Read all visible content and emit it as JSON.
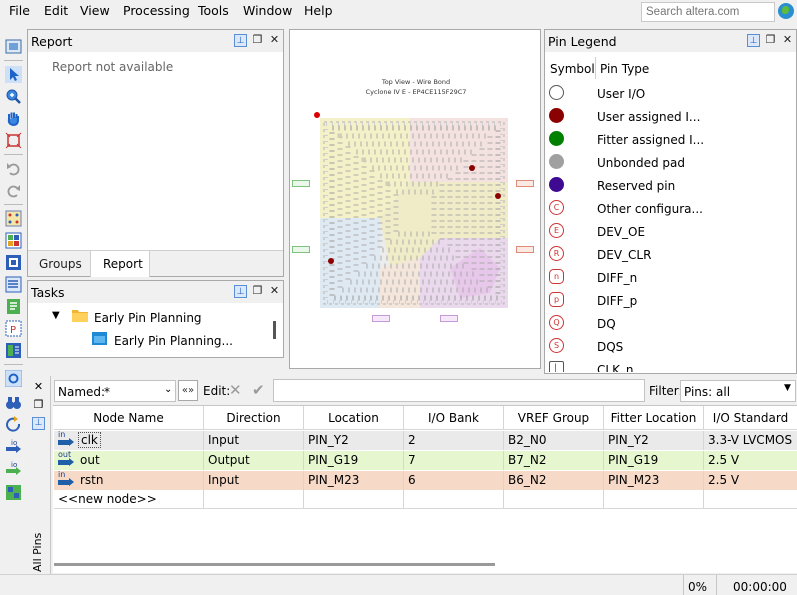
{
  "menu": [
    "File",
    "Edit",
    "View",
    "Processing",
    "Tools",
    "Window",
    "Help"
  ],
  "search": {
    "placeholder": "Search altera.com"
  },
  "report_panel": {
    "title": "Report",
    "empty_message": "Report not available",
    "tabs": [
      "Groups",
      "Report"
    ]
  },
  "tasks_panel": {
    "title": "Tasks",
    "items": [
      "Early Pin Planning",
      "Early Pin Planning..."
    ]
  },
  "chip_view": {
    "title": "Top View - Wire Bond",
    "subtitle": "Cyclone IV E - EP4CE115F29C7"
  },
  "pin_legend": {
    "title": "Pin Legend",
    "headers": [
      "Symbol",
      "Pin Type"
    ],
    "items": [
      {
        "label": "User I/O",
        "color": "#ffffff",
        "letter": ""
      },
      {
        "label": "User assigned I...",
        "color": "#8b0000",
        "letter": ""
      },
      {
        "label": "Fitter assigned I...",
        "color": "#008000",
        "letter": ""
      },
      {
        "label": "Unbonded pad",
        "color": "#a0a0a0",
        "letter": ""
      },
      {
        "label": "Reserved pin",
        "color": "#3d0a91",
        "letter": ""
      },
      {
        "label": "Other configura...",
        "color": "#ffffff",
        "letter": "C"
      },
      {
        "label": "DEV_OE",
        "color": "#ffffff",
        "letter": "E"
      },
      {
        "label": "DEV_CLR",
        "color": "#ffffff",
        "letter": "R"
      },
      {
        "label": "DIFF_n",
        "color": "#ffffff",
        "letter": "n"
      },
      {
        "label": "DIFF_p",
        "color": "#ffffff",
        "letter": "p"
      },
      {
        "label": "DQ",
        "color": "#ffffff",
        "letter": "Q"
      },
      {
        "label": "DQS",
        "color": "#ffffff",
        "letter": "S"
      },
      {
        "label": "CLK_n",
        "color": "#ffffff",
        "letter": "⎣"
      }
    ]
  },
  "filter_bar": {
    "named_label": "Named:",
    "named_value": "*",
    "edit_label": "Edit:",
    "filter_label": "Filter:",
    "filter_value": "Pins: all"
  },
  "pin_table": {
    "side_tab": "All Pins",
    "headers": [
      "Node Name",
      "Direction",
      "Location",
      "I/O Bank",
      "VREF Group",
      "Fitter Location",
      "I/O Standard"
    ],
    "rows": [
      {
        "dir_tag": "in",
        "name": "clk",
        "direction": "Input",
        "location": "PIN_Y2",
        "bank": "2",
        "vref": "B2_N0",
        "fitter": "PIN_Y2",
        "standard": "3.3-V LVCMOS",
        "bg": "#eaeaea"
      },
      {
        "dir_tag": "out",
        "name": "out",
        "direction": "Output",
        "location": "PIN_G19",
        "bank": "7",
        "vref": "B7_N2",
        "fitter": "PIN_G19",
        "standard": "2.5 V",
        "bg": "#e6f7cf"
      },
      {
        "dir_tag": "in",
        "name": "rstn",
        "direction": "Input",
        "location": "PIN_M23",
        "bank": "6",
        "vref": "B6_N2",
        "fitter": "PIN_M23",
        "standard": "2.5 V",
        "bg": "#f6d9c7"
      }
    ],
    "new_node": "<<new node>>"
  },
  "status": {
    "progress": "0%",
    "time": "00:00:00"
  }
}
